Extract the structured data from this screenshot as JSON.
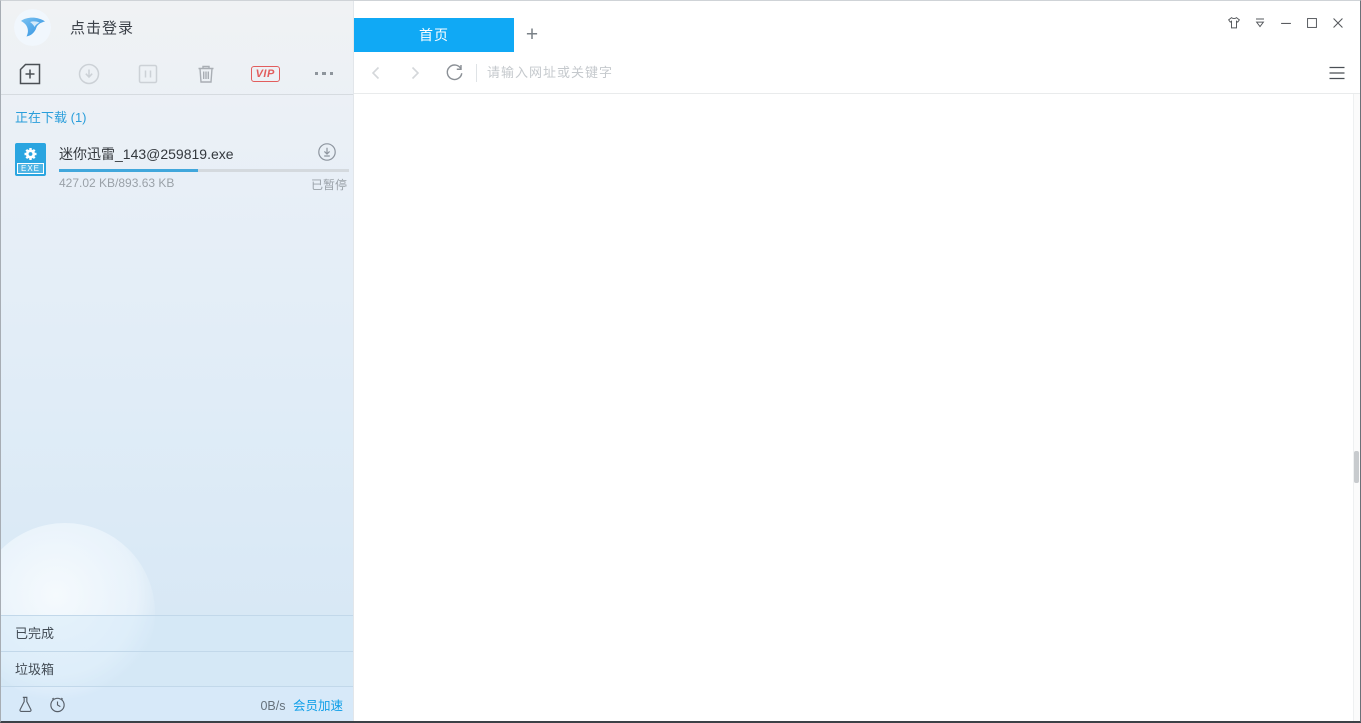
{
  "titlebar": {
    "login_label": "点击登录",
    "logo_icon": "thunder-bird-logo",
    "controls": {
      "skin_icon": "shirt-icon",
      "tray_icon": "collapse-triangle-icon",
      "minimize_icon": "minimize-icon",
      "maximize_icon": "maximize-icon",
      "close_icon": "close-icon"
    }
  },
  "toolbar": {
    "new_task_icon": "new-task-plus-icon",
    "resume_icon": "start-download-icon",
    "pause_icon": "pause-icon",
    "delete_icon": "trash-icon",
    "vip_label": "VIP",
    "more_icon": "more-dots-icon"
  },
  "download_list": {
    "section_title": "正在下载 (1)",
    "items": [
      {
        "file_name": "迷你迅雷_143@259819.exe",
        "file_type_badge": "EXE",
        "size_progress": "427.02 KB/893.63 KB",
        "status": "已暂停",
        "progress_percent": 47.8,
        "action_icon": "circle-download-icon"
      }
    ]
  },
  "sidebar_nav": {
    "items": [
      {
        "label": "已完成"
      },
      {
        "label": "垃圾箱"
      }
    ]
  },
  "statusbar": {
    "flask_icon": "flask-icon",
    "timer_icon": "alarm-clock-icon",
    "speed": "0B/s",
    "accelerate_label": "会员加速"
  },
  "browser": {
    "tabs": [
      {
        "label": "首页",
        "active": true
      }
    ],
    "new_tab_label": "+",
    "address_placeholder": "请输入网址或关键字",
    "menu_icon": "hamburger-menu-icon",
    "back_icon": "chevron-left-icon",
    "forward_icon": "chevron-right-icon",
    "refresh_icon": "refresh-icon"
  },
  "colors": {
    "accent_blue": "#10a9f5",
    "progress_blue": "#41a7dc",
    "link_blue": "#109fe8",
    "section_title_blue": "#2a9edb",
    "vip_red": "#e25d5d",
    "file_icon_blue": "#2aa5e0",
    "sidebar_bg_top": "#f0f2f4",
    "sidebar_bg_bottom": "#d6e7f5"
  }
}
